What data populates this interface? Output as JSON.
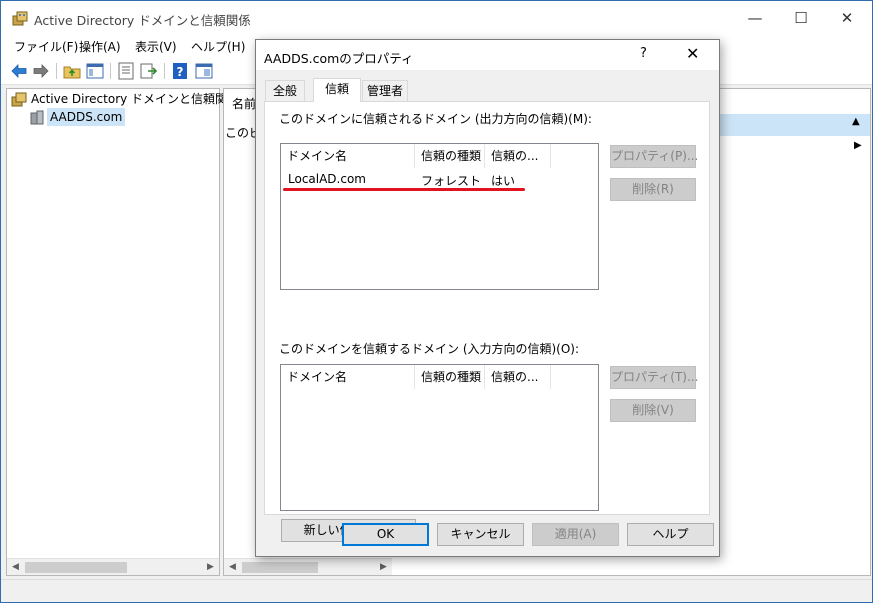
{
  "main_window": {
    "title": "Active Directory ドメインと信頼関係",
    "controls": {
      "minimize": "—",
      "maximize": "☐",
      "close": "✕"
    }
  },
  "menu": [
    {
      "label": "ファイル(F)"
    },
    {
      "label": "操作(A)"
    },
    {
      "label": "表示(V)"
    },
    {
      "label": "ヘルプ(H)"
    }
  ],
  "toolbar": {
    "icons": [
      "back-arrow-icon",
      "forward-arrow-icon",
      "up-folder-icon",
      "console-tree-icon",
      "properties-icon",
      "export-list-icon",
      "help-icon",
      "mmc-pane-icon"
    ]
  },
  "tree": {
    "root_label": "Active Directory ドメインと信頼関係 [",
    "child_label": "AADDS.com"
  },
  "right_pane": {
    "header_name": "名前",
    "desc_text": "このビュ"
  },
  "dialog": {
    "title": "AADDS.comのプロパティ",
    "help_glyph": "?",
    "close_glyph": "✕",
    "tabs": [
      {
        "label": "全般",
        "active": false
      },
      {
        "label": "信頼",
        "active": true
      },
      {
        "label": "管理者",
        "active": false
      }
    ],
    "outgoing": {
      "label": "このドメインに信頼されるドメイン (出力方向の信頼)(M):",
      "columns": [
        "ドメイン名",
        "信頼の種類",
        "信頼の..."
      ],
      "rows": [
        {
          "domain": "LocalAD.com",
          "type": "フォレスト",
          "transitive": "はい"
        }
      ],
      "properties_button": "プロパティ(P)...",
      "remove_button": "削除(R)"
    },
    "incoming": {
      "label": "このドメインを信頼するドメイン (入力方向の信頼)(O):",
      "columns": [
        "ドメイン名",
        "信頼の種類",
        "信頼の..."
      ],
      "rows": [],
      "properties_button": "プロパティ(T)...",
      "remove_button": "削除(V)"
    },
    "new_trust_button": "新しい信頼(N)...",
    "footer": {
      "ok": "OK",
      "cancel": "キャンセル",
      "apply": "適用(A)",
      "help": "ヘルプ"
    }
  },
  "colors": {
    "highlight_underline": "#e0131f",
    "selection": "#cce4f7",
    "default_button_border": "#0078d7",
    "header_band": "#cce4f7"
  }
}
